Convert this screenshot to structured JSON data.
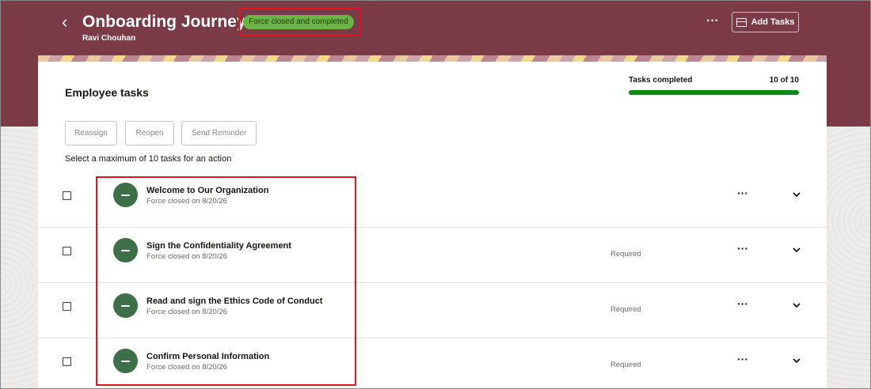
{
  "header": {
    "title": "Onboarding Journey",
    "subtitle": "Ravi Chouhan",
    "status_badge": "Force closed and completed",
    "add_tasks_label": "Add Tasks",
    "banner_color": "#7a3a46",
    "badge_color": "#6cb444",
    "icons": [
      "chevron-left-icon",
      "more-horizontal-icon",
      "add-tasks-icon"
    ]
  },
  "panel": {
    "section_title": "Employee tasks",
    "progress": {
      "label": "Tasks completed",
      "count_text": "10 of 10",
      "completed": 10,
      "total": 10,
      "fill_color": "#0e8a16"
    },
    "actions": [
      "Reassign",
      "Reopen",
      "Send Reminder"
    ],
    "hint": "Select a maximum of 10 tasks for an action",
    "tasks": [
      {
        "title": "Welcome to Our Organization",
        "subtitle": "Force closed on 8/20/26",
        "tag": ""
      },
      {
        "title": "Sign the Confidentiality Agreement",
        "subtitle": "Force closed on 8/20/26",
        "tag": "Required"
      },
      {
        "title": "Read and sign the Ethics Code of Conduct",
        "subtitle": "Force closed on 8/20/26",
        "tag": "Required"
      },
      {
        "title": "Confirm Personal Information",
        "subtitle": "Force closed on 8/20/26",
        "tag": "Required"
      }
    ],
    "task_status_color": "#3d6f48"
  },
  "annotations": {
    "highlight_color": "#e0141e"
  }
}
